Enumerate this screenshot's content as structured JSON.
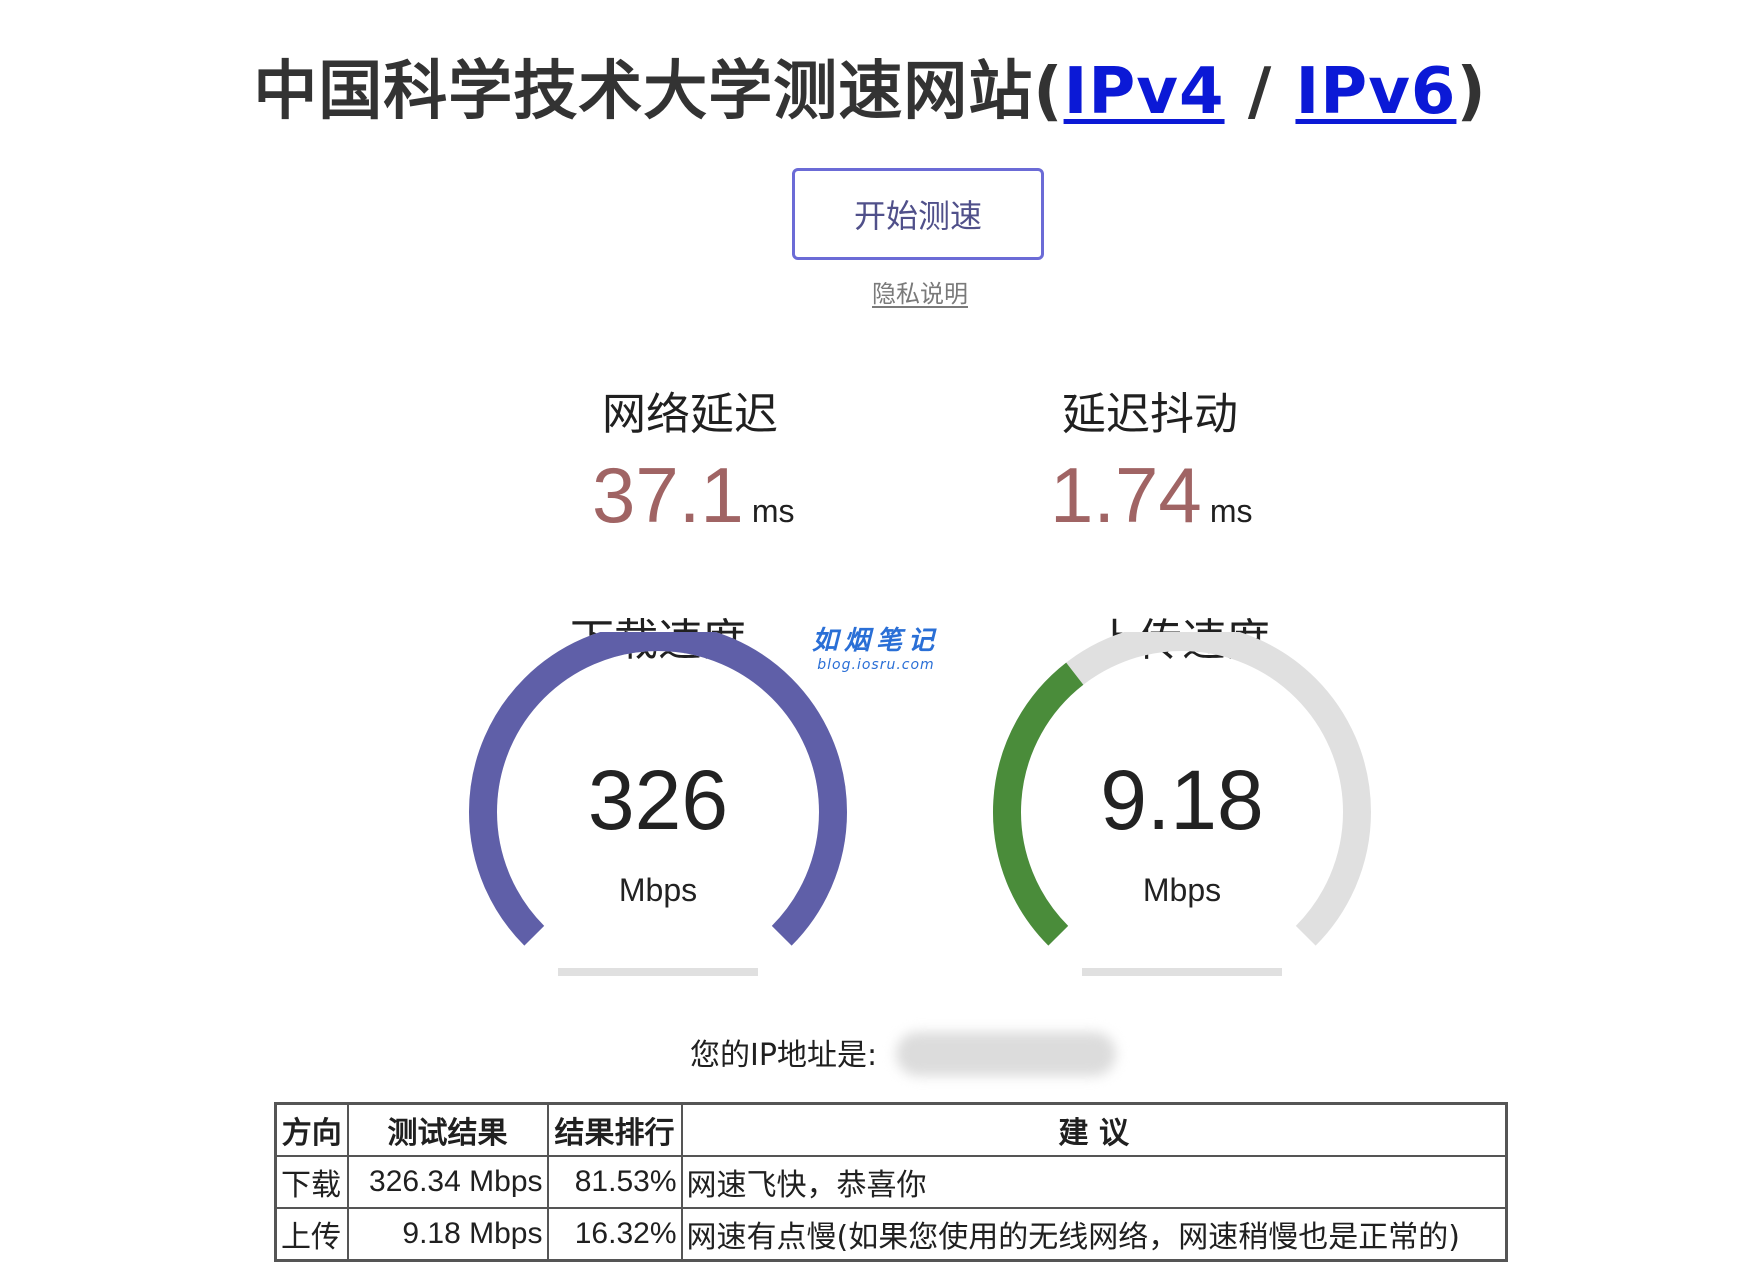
{
  "header": {
    "title_prefix": "中国科学技术大学测速网站(",
    "ipv4_link": "IPv4",
    "separator": " / ",
    "ipv6_link": "IPv6",
    "title_suffix": ")"
  },
  "controls": {
    "start_button": "开始测速",
    "privacy_link": "隐私说明"
  },
  "metrics": {
    "latency": {
      "label": "网络延迟",
      "value": "37.1",
      "unit": "ms"
    },
    "jitter": {
      "label": "延迟抖动",
      "value": "1.74",
      "unit": "ms"
    }
  },
  "gauges": {
    "download": {
      "label": "下载速度",
      "value": "326",
      "unit": "Mbps",
      "fill_fraction": 1.0,
      "color": "#5f5fa8"
    },
    "upload": {
      "label": "上传速度",
      "value": "9.18",
      "unit": "Mbps",
      "fill_fraction": 0.36,
      "color": "#4a8c3a"
    }
  },
  "watermark": {
    "title": "如烟笔记",
    "subtitle": "blog.iosru.com"
  },
  "ip": {
    "label": "您的IP地址是:"
  },
  "table": {
    "headers": [
      "方向",
      "测试结果",
      "结果排行",
      "建 议"
    ],
    "rows": [
      [
        "下载",
        "326.34 Mbps",
        "81.53%",
        "网速飞快，恭喜你"
      ],
      [
        "上传",
        "9.18 Mbps",
        "16.32%",
        "网速有点慢(如果您使用的无线网络，网速稍慢也是正常的)"
      ]
    ]
  },
  "colors": {
    "metric_value": "#a06464",
    "gauge_track": "#e0e0e0",
    "link": "#0b19d6"
  }
}
